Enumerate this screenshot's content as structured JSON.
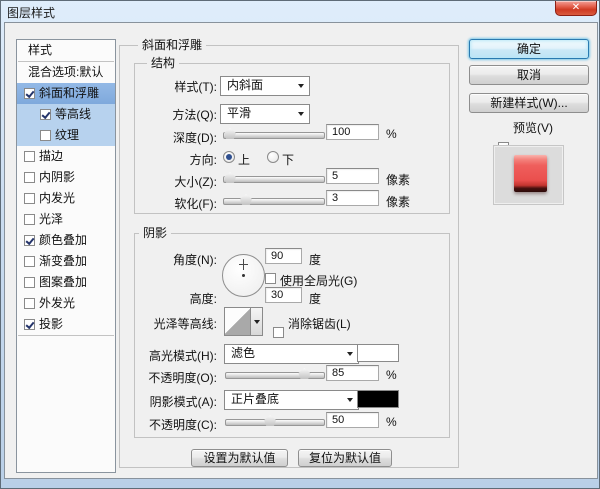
{
  "window": {
    "title": "图层样式"
  },
  "icons": {
    "close": "✕"
  },
  "sidebar": {
    "header": "样式",
    "blending_label": "混合选项:默认",
    "items": [
      {
        "label": "斜面和浮雕",
        "checked": true
      },
      {
        "label": "等高线",
        "checked": true
      },
      {
        "label": "纹理",
        "checked": false
      },
      {
        "label": "描边",
        "checked": false
      },
      {
        "label": "内阴影",
        "checked": false
      },
      {
        "label": "内发光",
        "checked": false
      },
      {
        "label": "光泽",
        "checked": false
      },
      {
        "label": "颜色叠加",
        "checked": true
      },
      {
        "label": "渐变叠加",
        "checked": false
      },
      {
        "label": "图案叠加",
        "checked": false
      },
      {
        "label": "外发光",
        "checked": false
      },
      {
        "label": "投影",
        "checked": true
      }
    ]
  },
  "panel": {
    "title": "斜面和浮雕",
    "structure": {
      "title": "结构",
      "style_label": "样式(T):",
      "style_value": "内斜面",
      "technique_label": "方法(Q):",
      "technique_value": "平滑",
      "depth_label": "深度(D):",
      "depth_value": "100",
      "depth_unit": "%",
      "depth_pct": "7%",
      "direction_label": "方向:",
      "direction_up": "上",
      "direction_down": "下",
      "size_label": "大小(Z):",
      "size_value": "5",
      "size_unit": "像素",
      "size_pct": "7%",
      "soften_label": "软化(F):",
      "soften_value": "3",
      "soften_unit": "像素",
      "soften_pct": "23%"
    },
    "shading": {
      "title": "阴影",
      "angle_label": "角度(N):",
      "angle_value": "90",
      "angle_unit": "度",
      "global_light_label": "使用全局光(G)",
      "altitude_label": "高度:",
      "altitude_value": "30",
      "altitude_unit": "度",
      "contour_label": "光泽等高线:",
      "anti_alias_label": "消除锯齿(L)",
      "highlight_mode_label": "高光模式(H):",
      "highlight_mode_value": "滤色",
      "highlight_swatch": "#ffffff",
      "highlight_opacity_label": "不透明度(O):",
      "highlight_opacity_value": "85",
      "highlight_opacity_unit": "%",
      "highlight_opacity_pct": "81%",
      "shadow_mode_label": "阴影模式(A):",
      "shadow_mode_value": "正片叠底",
      "shadow_swatch": "#000000",
      "shadow_opacity_label": "不透明度(C):",
      "shadow_opacity_value": "50",
      "shadow_opacity_unit": "%",
      "shadow_opacity_pct": "46%"
    },
    "footer": {
      "set_default": "设置为默认值",
      "reset_default": "复位为默认值"
    }
  },
  "actions": {
    "ok": "确定",
    "cancel": "取消",
    "new_style": "新建样式(W)...",
    "preview_label": "预览(V)"
  },
  "colors": {
    "selection": "#84aede",
    "selection_light": "#b7d2ee",
    "preview_red": "#ee5f5f",
    "close_red": "#d8503c",
    "titlebar_blue": "#cadcf0"
  }
}
